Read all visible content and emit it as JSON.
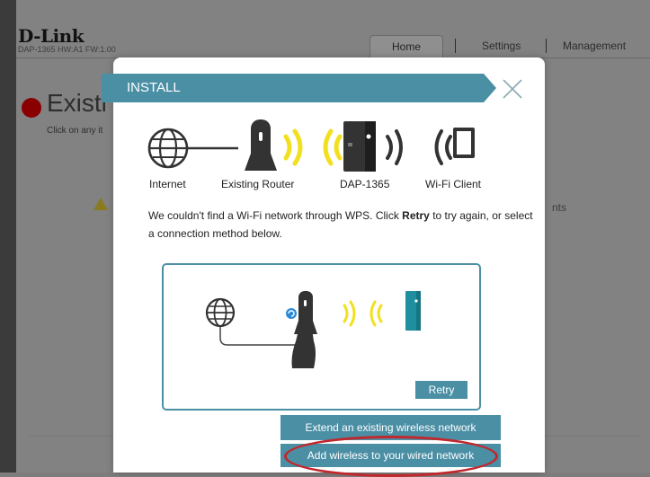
{
  "header": {
    "logo": "D-Link",
    "device_info": "DAP-1365   HW:A1   FW:1.00",
    "nav": {
      "home": "Home",
      "settings": "Settings",
      "management": "Management"
    }
  },
  "background_page": {
    "title": "Existi",
    "subtitle": "Click on any it",
    "right_text": "nts"
  },
  "modal": {
    "title": "INSTALL",
    "devices": {
      "internet": "Internet",
      "router": "Existing Router",
      "extender": "DAP-1365",
      "client": "Wi-Fi Client"
    },
    "message_pre": "We couldn't find a Wi-Fi network through WPS. Click ",
    "message_bold": "Retry",
    "message_post": " to try again, or select a connection method below.",
    "retry_label": "Retry",
    "options": {
      "extend": "Extend an existing wireless network",
      "add_wireless": "Add wireless to your wired network"
    }
  },
  "colors": {
    "accent": "#4b8fa5",
    "wave": "#f2e020",
    "device": "#1f8fa0",
    "highlight": "#c0282d"
  }
}
